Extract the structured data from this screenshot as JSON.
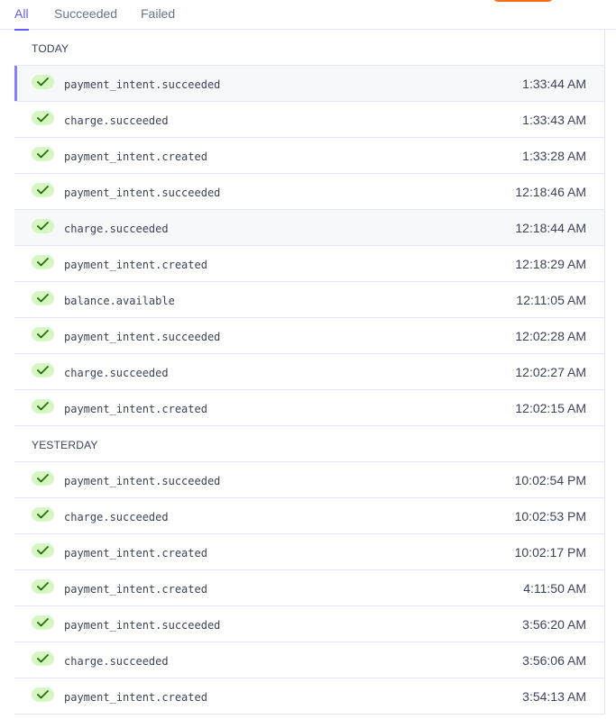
{
  "tabs": [
    {
      "label": "All",
      "active": true
    },
    {
      "label": "Succeeded",
      "active": false
    },
    {
      "label": "Failed",
      "active": false
    }
  ],
  "colors": {
    "accent": "#635bff",
    "success_bg": "#d7f7c2",
    "success_check": "#217005",
    "orange": "#f56c1a"
  },
  "sections": [
    {
      "title": "TODAY",
      "rows": [
        {
          "event": "payment_intent.succeeded",
          "time": "1:33:44 AM",
          "status": "succeeded",
          "selected": true
        },
        {
          "event": "charge.succeeded",
          "time": "1:33:43 AM",
          "status": "succeeded"
        },
        {
          "event": "payment_intent.created",
          "time": "1:33:28 AM",
          "status": "succeeded"
        },
        {
          "event": "payment_intent.succeeded",
          "time": "12:18:46 AM",
          "status": "succeeded"
        },
        {
          "event": "charge.succeeded",
          "time": "12:18:44 AM",
          "status": "succeeded",
          "hover": true
        },
        {
          "event": "payment_intent.created",
          "time": "12:18:29 AM",
          "status": "succeeded"
        },
        {
          "event": "balance.available",
          "time": "12:11:05 AM",
          "status": "succeeded"
        },
        {
          "event": "payment_intent.succeeded",
          "time": "12:02:28 AM",
          "status": "succeeded"
        },
        {
          "event": "charge.succeeded",
          "time": "12:02:27 AM",
          "status": "succeeded"
        },
        {
          "event": "payment_intent.created",
          "time": "12:02:15 AM",
          "status": "succeeded"
        }
      ]
    },
    {
      "title": "YESTERDAY",
      "rows": [
        {
          "event": "payment_intent.succeeded",
          "time": "10:02:54 PM",
          "status": "succeeded"
        },
        {
          "event": "charge.succeeded",
          "time": "10:02:53 PM",
          "status": "succeeded"
        },
        {
          "event": "payment_intent.created",
          "time": "10:02:17 PM",
          "status": "succeeded"
        },
        {
          "event": "payment_intent.created",
          "time": "4:11:50 AM",
          "status": "succeeded"
        },
        {
          "event": "payment_intent.succeeded",
          "time": "3:56:20 AM",
          "status": "succeeded"
        },
        {
          "event": "charge.succeeded",
          "time": "3:56:06 AM",
          "status": "succeeded"
        },
        {
          "event": "payment_intent.created",
          "time": "3:54:13 AM",
          "status": "succeeded"
        }
      ]
    }
  ]
}
